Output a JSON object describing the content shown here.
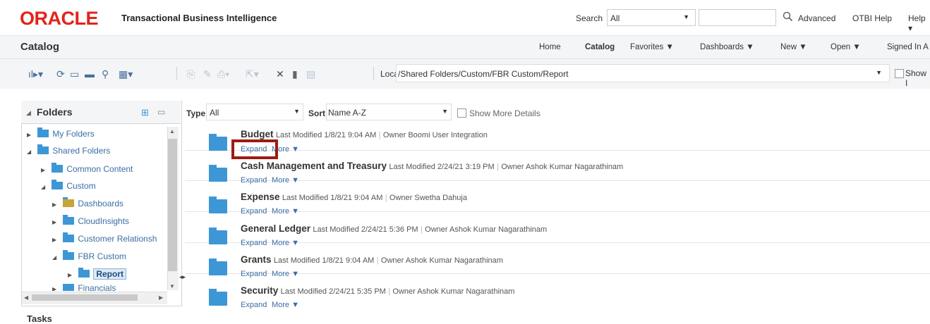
{
  "header": {
    "logo": "ORACLE",
    "product": "Transactional Business Intelligence",
    "search_label": "Search",
    "search_scope": "All",
    "search_value": "",
    "advanced": "Advanced",
    "otbi_help": "OTBI Help",
    "help": "Help",
    "help_arrow": "▾"
  },
  "page": {
    "title": "Catalog",
    "nav": [
      "Home",
      "Catalog",
      "Favorites ▼",
      "Dashboards ▼",
      "New ▼",
      "Open ▼",
      "Signed In A"
    ]
  },
  "toolbar": {
    "location_label": "Location",
    "location_path": "/Shared Folders/Custom/FBR Custom/Report",
    "show_label": "Show I"
  },
  "folders_panel": {
    "title": "Folders",
    "tree": [
      {
        "label": "My Folders",
        "twisty": "▶"
      },
      {
        "label": "Shared Folders",
        "twisty": "◢"
      },
      {
        "label": "Common Content",
        "twisty": "▶"
      },
      {
        "label": "Custom",
        "twisty": "◢"
      },
      {
        "label": "Dashboards",
        "twisty": "▶"
      },
      {
        "label": "CloudInsights",
        "twisty": "▶"
      },
      {
        "label": "Customer Relationsh",
        "twisty": "▶"
      },
      {
        "label": "FBR Custom",
        "twisty": "◢"
      },
      {
        "label": "Report",
        "twisty": "▶"
      },
      {
        "label": "Financials",
        "twisty": "▶"
      }
    ],
    "tasks": "Tasks"
  },
  "filters": {
    "type_label": "Type",
    "type_value": "All",
    "sort_label": "Sort",
    "sort_value": "Name A-Z",
    "show_more": "Show More Details"
  },
  "items": [
    {
      "name": "Budget",
      "modified": "Last Modified 1/8/21 9:04 AM",
      "owner": "Owner Boomi User Integration",
      "expand": "Expand",
      "more": "More ▼"
    },
    {
      "name": "Cash Management and Treasury",
      "modified": "Last Modified 2/24/21 3:19 PM",
      "owner": "Owner Ashok Kumar Nagarathinam",
      "expand": "Expand",
      "more": "More ▼"
    },
    {
      "name": "Expense",
      "modified": "Last Modified 1/8/21 9:04 AM",
      "owner": "Owner Swetha Dahuja",
      "expand": "Expand",
      "more": "More ▼"
    },
    {
      "name": "General Ledger",
      "modified": "Last Modified 2/24/21 5:36 PM",
      "owner": "Owner Ashok Kumar Nagarathinam",
      "expand": "Expand",
      "more": "More ▼"
    },
    {
      "name": "Grants",
      "modified": "Last Modified 1/8/21 9:04 AM",
      "owner": "Owner Ashok Kumar Nagarathinam",
      "expand": "Expand",
      "more": "More ▼"
    },
    {
      "name": "Security",
      "modified": "Last Modified 2/24/21 5:35 PM",
      "owner": "Owner Ashok Kumar Nagarathinam",
      "expand": "Expand",
      "more": "More ▼"
    }
  ],
  "colors": {
    "brand": "#e1251b",
    "folder": "#3d97d6",
    "link": "#3b6ea5",
    "highlight": "#9c1c13"
  }
}
